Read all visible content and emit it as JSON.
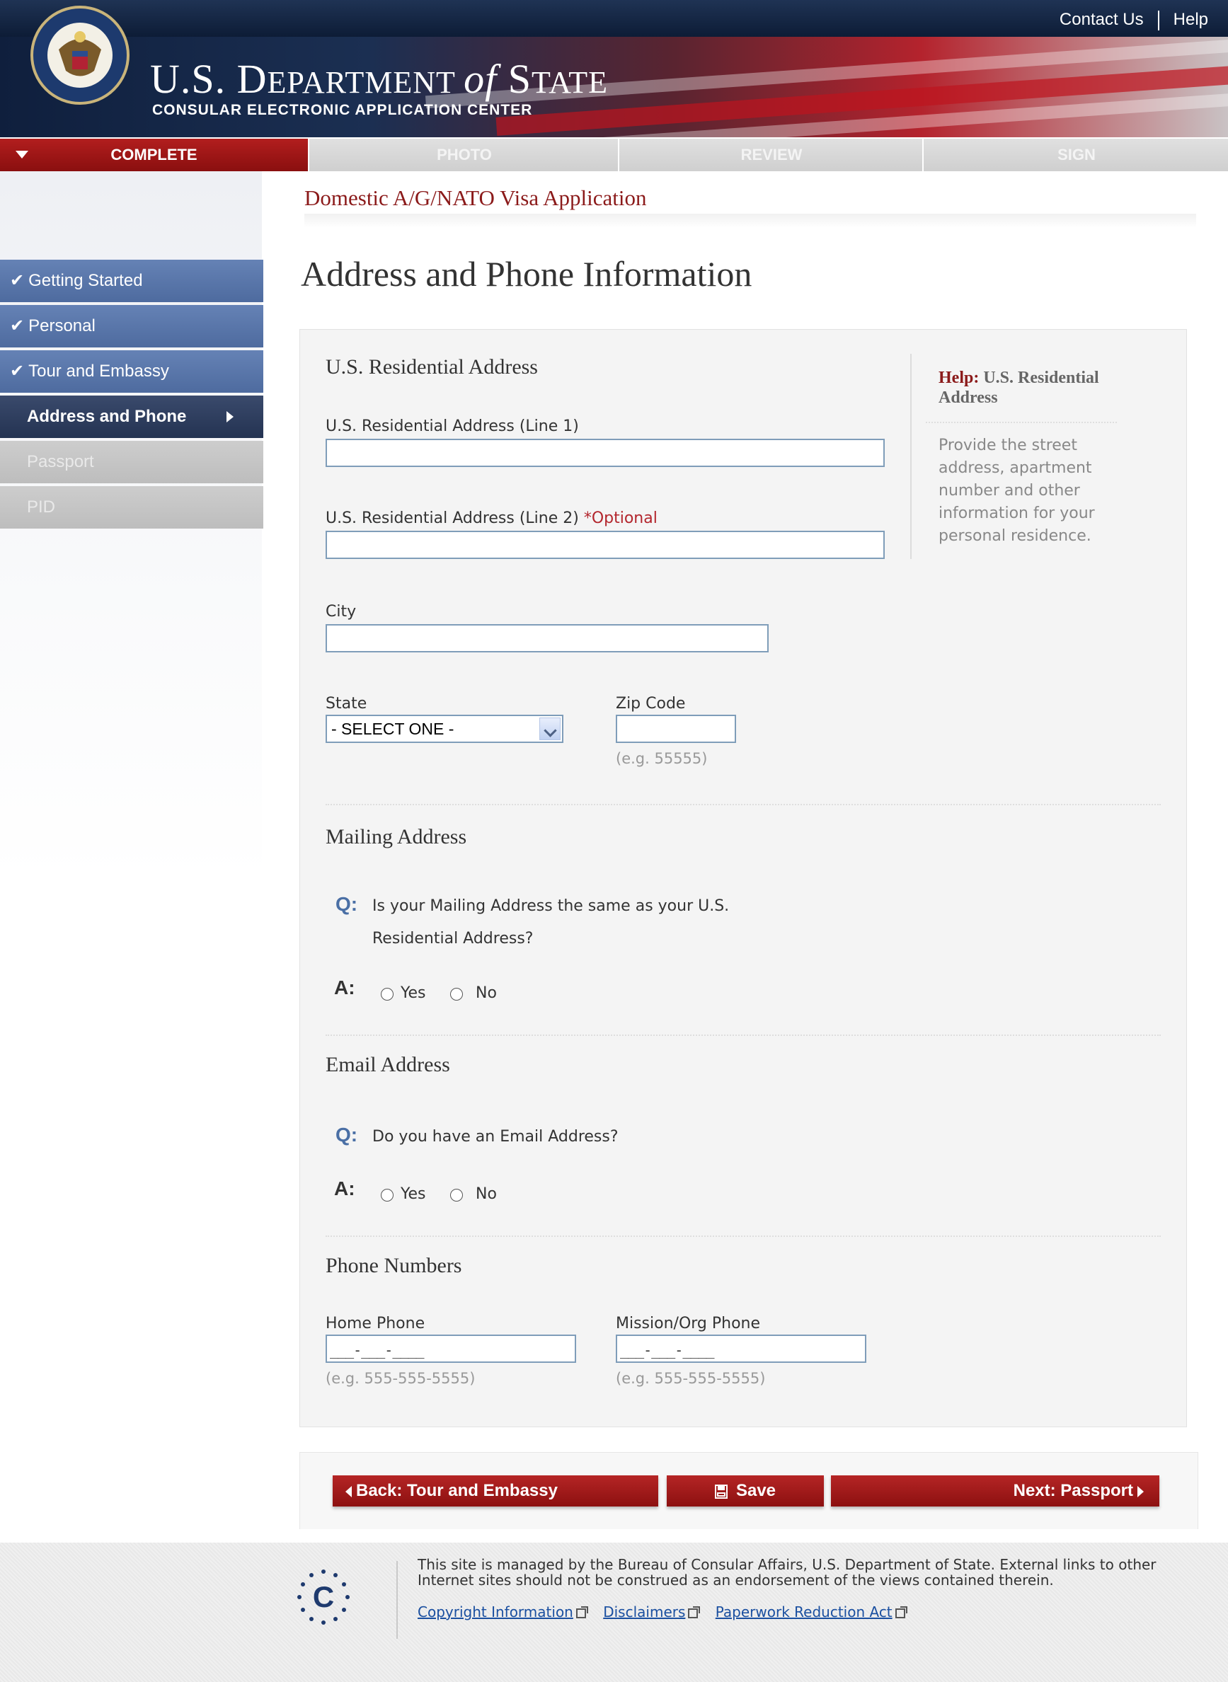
{
  "header": {
    "contact_link": "Contact Us",
    "help_link": "Help",
    "site_title_a": "U.S. D",
    "site_title_b": "EPARTMENT ",
    "site_title_of": "of",
    "site_title_c": " S",
    "site_title_d": "TATE",
    "site_subtitle": "CONSULAR ELECTRONIC APPLICATION CENTER",
    "seal_text": "DEPARTMENT OF STATE · UNITED STATES OF AMERICA"
  },
  "progress_tabs": [
    {
      "label": "COMPLETE",
      "state": "active"
    },
    {
      "label": "PHOTO",
      "state": "inactive"
    },
    {
      "label": "REVIEW",
      "state": "inactive"
    },
    {
      "label": "SIGN",
      "state": "inactive"
    }
  ],
  "sidebar": {
    "items": [
      {
        "label": "Getting Started",
        "state": "done"
      },
      {
        "label": "Personal",
        "state": "done"
      },
      {
        "label": "Tour and Embassy",
        "state": "done"
      },
      {
        "label": "Address and Phone",
        "state": "current"
      },
      {
        "label": "Passport",
        "state": "todo"
      },
      {
        "label": "PID",
        "state": "todo"
      }
    ],
    "check_mark": "✔"
  },
  "main": {
    "app_title": "Domestic A/G/NATO Visa Application",
    "page_title": "Address and Phone Information"
  },
  "residential": {
    "section_title": "U.S. Residential Address",
    "line1_label": "U.S. Residential Address (Line 1)",
    "line1_value": "",
    "line2_label": "U.S. Residential Address (Line 2) ",
    "line2_optional": "*Optional",
    "line2_value": "",
    "city_label": "City",
    "city_value": "",
    "state_label": "State",
    "state_selected": "- SELECT ONE -",
    "zip_label": "Zip Code",
    "zip_value": "",
    "zip_hint": "(e.g. 55555)"
  },
  "help": {
    "title_lead": "Help:",
    "title_rest": " U.S. Residential Address",
    "text": "Provide the street address, apartment number and other information for your personal residence."
  },
  "mailing": {
    "section_title": "Mailing Address",
    "q_marker": "Q:",
    "question_line1": "Is your Mailing Address the same as your U.S.",
    "question_line2": "Residential Address?",
    "a_marker": "A:",
    "yes_label": "Yes",
    "no_label": "No"
  },
  "email": {
    "section_title": "Email Address",
    "q_marker": "Q:",
    "question": "Do you have an Email Address?",
    "a_marker": "A:",
    "yes_label": "Yes",
    "no_label": "No"
  },
  "phones": {
    "section_title": "Phone Numbers",
    "home_label": "Home Phone",
    "home_value": "___-___-____",
    "home_hint": "(e.g. 555-555-5555)",
    "mission_label": "Mission/Org Phone",
    "mission_value": "___-___-____",
    "mission_hint": "(e.g. 555-555-5555)"
  },
  "nav": {
    "back_label": "Back: Tour and Embassy",
    "save_label": "Save",
    "next_label": "Next: Passport"
  },
  "footer": {
    "text": "This site is managed by the Bureau of Consular Affairs, U.S. Department of State. External links to other Internet sites should not be construed as an endorsement of the views contained therein.",
    "links": [
      "Copyright Information",
      "Disclaimers",
      "Paperwork Reduction Act"
    ],
    "logo_letter": "C"
  },
  "colors": {
    "accent_red": "#8b1a1a",
    "nav_blue": "#4e6b9f",
    "link_blue": "#1a4fa0"
  }
}
